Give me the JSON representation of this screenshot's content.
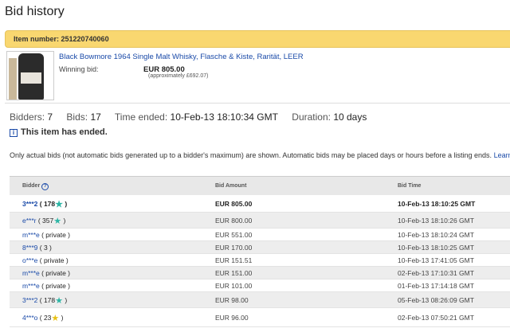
{
  "page": {
    "title": "Bid history"
  },
  "item": {
    "number_label": "Item number: 251220740060",
    "title": "Black Bowmore 1964 Single Malt Whisky, Flasche & Kiste, Rarität, LEER",
    "winning_label": "Winning bid:",
    "winning_value": "EUR 805.00",
    "winning_approx": "(approximately £692.07)"
  },
  "stats": {
    "bidders_label": "Bidders:",
    "bidders_value": "7",
    "bids_label": "Bids:",
    "bids_value": "17",
    "time_label": "Time ended:",
    "time_value": "10-Feb-13 18:10:34 GMT",
    "duration_label": "Duration:",
    "duration_value": "10 days"
  },
  "ended_text": "This item has ended.",
  "note": {
    "text": "Only actual bids (not automatic bids generated up to a bidder's maximum) are shown. Automatic bids may be placed days or hours before a listing ends.",
    "link": "Learn mor"
  },
  "table": {
    "headers": {
      "bidder": "Bidder",
      "amount": "Bid Amount",
      "time": "Bid Time"
    },
    "rows": [
      {
        "bidder": "3***2",
        "score": "( 178",
        "star": "teal",
        "close": ")",
        "amount": "EUR 805.00",
        "time": "10-Feb-13 18:10:25 GMT"
      },
      {
        "bidder": "e***r",
        "score": "( 357",
        "star": "teal",
        "close": ")",
        "amount": "EUR 800.00",
        "time": "10-Feb-13 18:10:26 GMT"
      },
      {
        "bidder": "m***e",
        "score": "( private )",
        "star": "",
        "close": "",
        "amount": "EUR 551.00",
        "time": "10-Feb-13 18:10:24 GMT"
      },
      {
        "bidder": "8***9",
        "score": "( 3 )",
        "star": "",
        "close": "",
        "amount": "EUR 170.00",
        "time": "10-Feb-13 18:10:25 GMT"
      },
      {
        "bidder": "o***e",
        "score": "( private )",
        "star": "",
        "close": "",
        "amount": "EUR 151.51",
        "time": "10-Feb-13 17:41:05 GMT"
      },
      {
        "bidder": "m***e",
        "score": "( private )",
        "star": "",
        "close": "",
        "amount": "EUR 151.00",
        "time": "02-Feb-13 17:10:31 GMT"
      },
      {
        "bidder": "m***e",
        "score": "( private )",
        "star": "",
        "close": "",
        "amount": "EUR 101.00",
        "time": "01-Feb-13 17:14:18 GMT"
      },
      {
        "bidder": "3***2",
        "score": "( 178",
        "star": "teal",
        "close": ")",
        "amount": "EUR 98.00",
        "time": "05-Feb-13 08:26:09 GMT"
      },
      {
        "bidder": "4***o",
        "score": "( 23",
        "star": "yellow",
        "close": ")",
        "amount": "EUR 96.00",
        "time": "02-Feb-13 07:50:21 GMT"
      }
    ]
  },
  "colors": {
    "accent_bar": "#f9d770",
    "link": "#1a4aa8",
    "star_teal": "#2cb5a5",
    "star_yellow": "#e8c114"
  }
}
